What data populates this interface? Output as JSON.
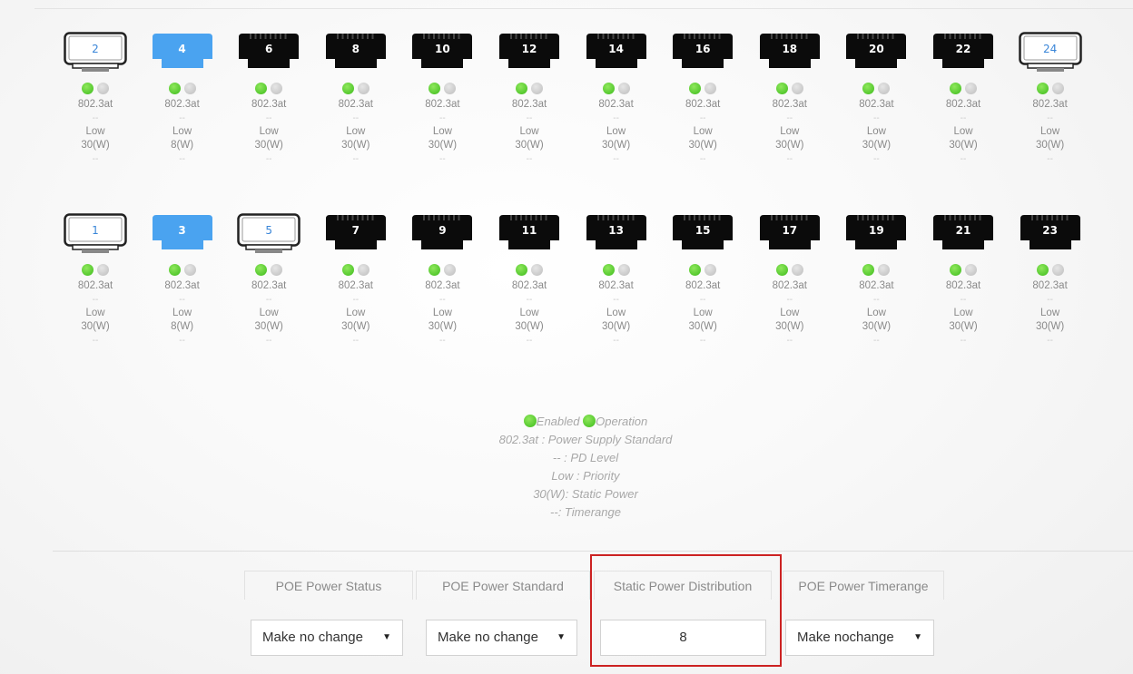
{
  "ports_top": [
    {
      "num": "2",
      "style": "white",
      "info": [
        "802.3at",
        "--",
        "Low",
        "30(W)",
        "--"
      ]
    },
    {
      "num": "4",
      "style": "blue",
      "info": [
        "802.3at",
        "--",
        "Low",
        "8(W)",
        "--"
      ]
    },
    {
      "num": "6",
      "style": "black",
      "info": [
        "802.3at",
        "--",
        "Low",
        "30(W)",
        "--"
      ]
    },
    {
      "num": "8",
      "style": "black",
      "info": [
        "802.3at",
        "--",
        "Low",
        "30(W)",
        "--"
      ]
    },
    {
      "num": "10",
      "style": "black",
      "info": [
        "802.3at",
        "--",
        "Low",
        "30(W)",
        "--"
      ]
    },
    {
      "num": "12",
      "style": "black",
      "info": [
        "802.3at",
        "--",
        "Low",
        "30(W)",
        "--"
      ]
    },
    {
      "num": "14",
      "style": "black",
      "info": [
        "802.3at",
        "--",
        "Low",
        "30(W)",
        "--"
      ]
    },
    {
      "num": "16",
      "style": "black",
      "info": [
        "802.3at",
        "--",
        "Low",
        "30(W)",
        "--"
      ]
    },
    {
      "num": "18",
      "style": "black",
      "info": [
        "802.3at",
        "--",
        "Low",
        "30(W)",
        "--"
      ]
    },
    {
      "num": "20",
      "style": "black",
      "info": [
        "802.3at",
        "--",
        "Low",
        "30(W)",
        "--"
      ]
    },
    {
      "num": "22",
      "style": "black",
      "info": [
        "802.3at",
        "--",
        "Low",
        "30(W)",
        "--"
      ]
    },
    {
      "num": "24",
      "style": "white",
      "info": [
        "802.3at",
        "--",
        "Low",
        "30(W)",
        "--"
      ]
    }
  ],
  "ports_bottom": [
    {
      "num": "1",
      "style": "white",
      "info": [
        "802.3at",
        "--",
        "Low",
        "30(W)",
        "--"
      ]
    },
    {
      "num": "3",
      "style": "blue",
      "info": [
        "802.3at",
        "--",
        "Low",
        "8(W)",
        "--"
      ]
    },
    {
      "num": "5",
      "style": "white",
      "info": [
        "802.3at",
        "--",
        "Low",
        "30(W)",
        "--"
      ]
    },
    {
      "num": "7",
      "style": "black",
      "info": [
        "802.3at",
        "--",
        "Low",
        "30(W)",
        "--"
      ]
    },
    {
      "num": "9",
      "style": "black",
      "info": [
        "802.3at",
        "--",
        "Low",
        "30(W)",
        "--"
      ]
    },
    {
      "num": "11",
      "style": "black",
      "info": [
        "802.3at",
        "--",
        "Low",
        "30(W)",
        "--"
      ]
    },
    {
      "num": "13",
      "style": "black",
      "info": [
        "802.3at",
        "--",
        "Low",
        "30(W)",
        "--"
      ]
    },
    {
      "num": "15",
      "style": "black",
      "info": [
        "802.3at",
        "--",
        "Low",
        "30(W)",
        "--"
      ]
    },
    {
      "num": "17",
      "style": "black",
      "info": [
        "802.3at",
        "--",
        "Low",
        "30(W)",
        "--"
      ]
    },
    {
      "num": "19",
      "style": "black",
      "info": [
        "802.3at",
        "--",
        "Low",
        "30(W)",
        "--"
      ]
    },
    {
      "num": "21",
      "style": "black",
      "info": [
        "802.3at",
        "--",
        "Low",
        "30(W)",
        "--"
      ]
    },
    {
      "num": "23",
      "style": "black",
      "info": [
        "802.3at",
        "--",
        "Low",
        "30(W)",
        "--"
      ]
    }
  ],
  "legend": {
    "enabled": "Enabled",
    "operation": "Operation",
    "standard": "802.3at : Power Supply Standard",
    "pd_level": "-- : PD Level",
    "priority": "Low : Priority",
    "static_power": "30(W): Static Power",
    "timerange": "--: Timerange"
  },
  "settings": {
    "status_header": "POE Power Status",
    "standard_header": "POE Power Standard",
    "static_header": "Static Power Distribution",
    "timerange_header": "POE Power Timerange",
    "status_value": "Make no change",
    "standard_value": "Make no change",
    "static_value": "8",
    "timerange_value": "Make nochange"
  },
  "colors": {
    "port_black": "#0b0b0b",
    "port_blue": "#4aa3f0",
    "port_white": "#ffffff",
    "led_green": "#3dbb1c",
    "led_gray": "#c4c4c4",
    "highlight": "#cc2222"
  }
}
